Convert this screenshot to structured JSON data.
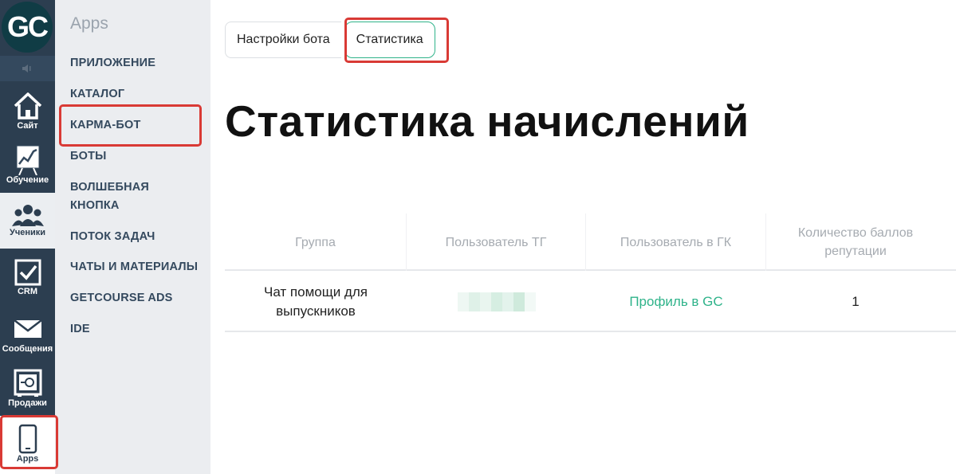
{
  "logo": {
    "text": "GC"
  },
  "rail": {
    "items": [
      {
        "label": "Сайт",
        "icon": "home-icon"
      },
      {
        "label": "Обучение",
        "icon": "chart-icon"
      },
      {
        "label": "Ученики",
        "icon": "users-icon"
      },
      {
        "label": "CRM",
        "icon": "check-box-icon"
      },
      {
        "label": "Сообщения",
        "icon": "envelope-icon"
      },
      {
        "label": "Продажи",
        "icon": "safe-icon"
      },
      {
        "label": "Apps",
        "icon": "phone-icon"
      }
    ]
  },
  "submenu": {
    "title": "Apps",
    "items": [
      {
        "label": "ПРИЛОЖЕНИЕ"
      },
      {
        "label": "КАТАЛОГ"
      },
      {
        "label": "КАРМА-БОТ"
      },
      {
        "label": "БОТЫ"
      },
      {
        "label": "ВОЛШЕБНАЯ"
      },
      {
        "label": "КНОПКА"
      },
      {
        "label": "ПОТОК ЗАДАЧ"
      },
      {
        "label": "ЧАТЫ И МАТЕРИАЛЫ"
      },
      {
        "label": "GETCOURSE ADS"
      },
      {
        "label": "IDE"
      }
    ]
  },
  "tabs": [
    {
      "label": "Настройки бота"
    },
    {
      "label": "Статистика"
    }
  ],
  "page": {
    "title": "Статистика начислений"
  },
  "table": {
    "headers": [
      "Группа",
      "Пользователь ТГ",
      "Пользователь в ГК",
      "Количество баллов",
      "репутации"
    ],
    "rows": [
      {
        "group_line1": "Чат помощи для",
        "group_line2": "выпускников",
        "tg_user": "",
        "gk_user": "Профиль в GC",
        "points": "1"
      }
    ]
  },
  "colors": {
    "accent": "#2fb38a",
    "highlight": "#d93a35",
    "rail": "#2c3e50"
  }
}
